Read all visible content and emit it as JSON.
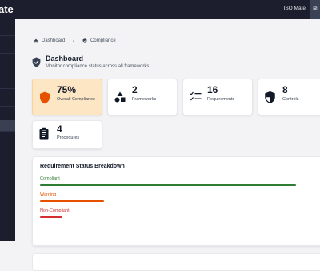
{
  "topbar": {
    "app_title": "ate",
    "user_name": "ISO Mate"
  },
  "breadcrumb": {
    "home": "Dashboard",
    "separator": "/",
    "current": "Compliance"
  },
  "page": {
    "title": "Dashboard",
    "subtitle": "Monitor compliance status across all frameworks"
  },
  "stats": [
    {
      "value": "75%",
      "label": "Overall Compliance",
      "icon": "shield-icon"
    },
    {
      "value": "2",
      "label": "Frameworks",
      "icon": "shapes-icon"
    },
    {
      "value": "16",
      "label": "Requirements",
      "icon": "checklist-icon"
    },
    {
      "value": "8",
      "label": "Controls",
      "icon": "shield-half-icon"
    },
    {
      "value": "4",
      "label": "Procedures",
      "icon": "clipboard-icon"
    }
  ],
  "breakdown": {
    "title": "Requirement Status Breakdown",
    "items": [
      {
        "label": "Compliant",
        "fraction": 0.92,
        "color": "#2e7d32"
      },
      {
        "label": "Warning",
        "fraction": 0.23,
        "color": "#e65100"
      },
      {
        "label": "Non-Compliant",
        "fraction": 0.08,
        "color": "#d32f2f"
      }
    ]
  },
  "colors": {
    "accent": "#e65100",
    "sidebar": "#1c1e2e"
  }
}
